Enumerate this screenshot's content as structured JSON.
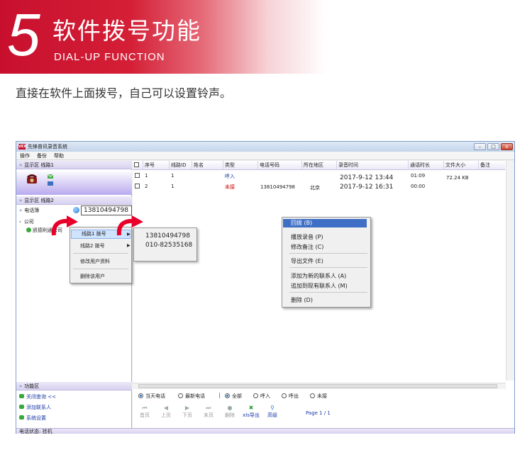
{
  "banner": {
    "number": "5",
    "title": "软件拨号功能",
    "subtitle": "DIAL-UP FUNCTION",
    "caption": "直接在软件上面拨号，自己可以设置铃声。"
  },
  "window": {
    "logo": "VEX",
    "title": "先锋普讯录音系统",
    "menu": [
      "操作",
      "备份",
      "帮助"
    ],
    "buttons": {
      "minimize": "–",
      "maximize": "□",
      "close": "x"
    }
  },
  "sidebar": {
    "section1": "显示区 线路1",
    "section2": "显示区 线路2",
    "dial_label": "电话簿",
    "dial_value": "13810494798",
    "tree_group": "公司",
    "tree_contact": "凯德利通公司",
    "func_header": "功能区",
    "func_items": [
      "关闭查询 <<",
      "添加联系人",
      "系统设置"
    ]
  },
  "table": {
    "columns": [
      "序号",
      "线路ID",
      "姓名",
      "类型",
      "电话号码",
      "所在地区",
      "录音时间",
      "通话时长",
      "文件大小",
      "备注"
    ],
    "rows": [
      {
        "no": "1",
        "line": "1",
        "name": "",
        "type": "呼入",
        "phone": "",
        "area": "",
        "time": "2017-9-12 13:44",
        "duration": "01:09",
        "size": "72.24 KB",
        "note": ""
      },
      {
        "no": "2",
        "line": "1",
        "name": "",
        "type": "未接",
        "phone": "13810494798",
        "area": "北京",
        "time": "2017-9-12 16:31",
        "duration": "00:00",
        "size": "",
        "note": ""
      }
    ]
  },
  "filters": {
    "date_options": [
      "当天电话",
      "最新电话"
    ],
    "type_options": [
      "全部",
      "呼入",
      "呼出",
      "未接"
    ],
    "separator": "|"
  },
  "toolbar": {
    "buttons": [
      "首页",
      "上页",
      "下页",
      "末页",
      "删除",
      "xls导出",
      "高级"
    ],
    "page": "Page 1 / 1"
  },
  "status": "电话状态: 挂机",
  "contact_menu": {
    "items": [
      "线路1 拨号",
      "线路2 拨号",
      "修改用户资料",
      "删除该用户"
    ],
    "submenu": [
      "13810494798",
      "010-82535168"
    ]
  },
  "record_menu": {
    "items": [
      "回拨 (B)",
      "播放录音 (P)",
      "修改备注 (C)",
      "导出文件 (E)",
      "添加为新的联系人 (A)",
      "追加到现有联系人 (M)",
      "删除 (D)"
    ]
  },
  "colors": {
    "brand_red": "#c8102e",
    "missed": "#d10000",
    "link_blue": "#1a3aa6",
    "menu_highlight": "#3e6fc4"
  }
}
